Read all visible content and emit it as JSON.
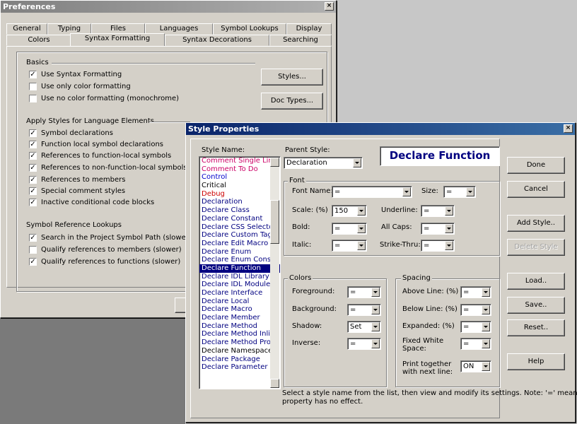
{
  "prefs": {
    "title": "Preferences",
    "close": "×",
    "tabs_top": [
      "General",
      "Typing",
      "Files",
      "Languages",
      "Symbol Lookups",
      "Display"
    ],
    "tabs_bottom": [
      "Colors",
      "Syntax Formatting",
      "Syntax Decorations",
      "Searching"
    ],
    "basics": {
      "label": "Basics",
      "items": [
        {
          "label": "Use Syntax Formatting",
          "checked": true
        },
        {
          "label": "Use only color formatting",
          "checked": false
        },
        {
          "label": "Use no color formatting (monochrome)",
          "checked": false
        }
      ]
    },
    "apply": {
      "label": "Apply Styles for Language Elements",
      "items": [
        {
          "label": "Symbol declarations",
          "checked": true
        },
        {
          "label": "Function local symbol declarations",
          "checked": true
        },
        {
          "label": "References to function-local symbols",
          "checked": true
        },
        {
          "label": "References to non-function-local symbols",
          "checked": true
        },
        {
          "label": "References to members",
          "checked": true
        },
        {
          "label": "Special comment styles",
          "checked": true
        },
        {
          "label": "Inactive conditional code blocks",
          "checked": true
        }
      ]
    },
    "lookup": {
      "label": "Symbol Reference Lookups",
      "items": [
        {
          "label": "Search in the Project Symbol Path (slower)",
          "checked": true
        },
        {
          "label": "Qualify references to members (slower)",
          "checked": false
        },
        {
          "label": "Qualify references to functions (slower)",
          "checked": true
        }
      ]
    },
    "styles_btn": "Styles...",
    "doctypes_btn": "Doc Types..."
  },
  "sp": {
    "title": "Style Properties",
    "close": "×",
    "style_name_label": "Style Name:",
    "styles": [
      {
        "n": "Comment Single Line",
        "c": "#cc0066"
      },
      {
        "n": "Comment To Do",
        "c": "#cc0066"
      },
      {
        "n": "Control",
        "c": "#0000cc"
      },
      {
        "n": "Critical",
        "c": "#000000"
      },
      {
        "n": "Debug",
        "c": "#cc0000"
      },
      {
        "n": "Declaration",
        "c": "#000080"
      },
      {
        "n": "Declare Class",
        "c": "#000080"
      },
      {
        "n": "Declare Constant",
        "c": "#000080"
      },
      {
        "n": "Declare CSS Selector",
        "c": "#000080"
      },
      {
        "n": "Declare Custom Tag",
        "c": "#000080"
      },
      {
        "n": "Declare Edit Macro",
        "c": "#000080"
      },
      {
        "n": "Declare Enum",
        "c": "#000080"
      },
      {
        "n": "Declare Enum Const",
        "c": "#000080"
      },
      {
        "n": "Declare Function",
        "c": "#ffffff",
        "sel": true
      },
      {
        "n": "Declare IDL Library",
        "c": "#000080"
      },
      {
        "n": "Declare IDL Module",
        "c": "#000080"
      },
      {
        "n": "Declare Interface",
        "c": "#000080"
      },
      {
        "n": "Declare Local",
        "c": "#000080"
      },
      {
        "n": "Declare Macro",
        "c": "#000080"
      },
      {
        "n": "Declare Member",
        "c": "#000080"
      },
      {
        "n": "Declare Method",
        "c": "#000080"
      },
      {
        "n": "Declare Method Inline",
        "c": "#000080"
      },
      {
        "n": "Declare Method Proto",
        "c": "#000080"
      },
      {
        "n": "Declare Namespace",
        "c": "#000000"
      },
      {
        "n": "Declare Package",
        "c": "#000080"
      },
      {
        "n": "Declare Parameter",
        "c": "#000080"
      }
    ],
    "parent_label": "Parent Style:",
    "parent_value": "Declaration",
    "preview": "Declare  Function",
    "font": {
      "label": "Font",
      "font_name_label": "Font Name:",
      "font_name": "=",
      "size_label": "Size:",
      "size": "=",
      "scale_label": "Scale: (%)",
      "scale": "150",
      "underline_label": "Underline:",
      "underline": "=",
      "bold_label": "Bold:",
      "bold": "=",
      "allcaps_label": "All Caps:",
      "allcaps": "=",
      "italic_label": "Italic:",
      "italic": "=",
      "strike_label": "Strike-Thru:",
      "strike": "="
    },
    "colors": {
      "label": "Colors",
      "fg_label": "Foreground:",
      "fg": "=",
      "bg_label": "Background:",
      "bg": "=",
      "shadow_label": "Shadow:",
      "shadow": "Set",
      "inverse_label": "Inverse:",
      "inverse": "="
    },
    "spacing": {
      "label": "Spacing",
      "above_label": "Above Line: (%)",
      "above": "=",
      "below_label": "Below Line: (%)",
      "below": "=",
      "expanded_label": "Expanded: (%)",
      "expanded": "=",
      "fixed_label_1": "Fixed White",
      "fixed_label_2": "Space:",
      "fixed": "=",
      "print_label_1": "Print together",
      "print_label_2": "with next line:",
      "print": "ON"
    },
    "buttons": {
      "done": "Done",
      "cancel": "Cancel",
      "add": "Add Style..",
      "delete": "Delete Style",
      "load": "Load..",
      "save": "Save..",
      "reset": "Reset..",
      "help": "Help"
    },
    "note_1": "Select a style name from the list, then view and modify its settings. Note: '=' means the",
    "note_2": "property has no effect."
  },
  "colors": {
    "title_active": "#0a246a",
    "title_inactive": "#808080"
  }
}
